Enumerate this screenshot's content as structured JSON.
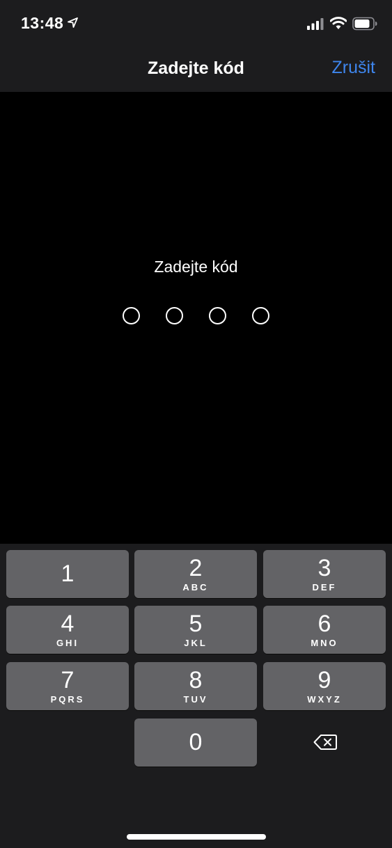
{
  "status_bar": {
    "time": "13:48",
    "icons": [
      "location-arrow-icon",
      "cellular-signal-icon",
      "wifi-icon",
      "battery-icon"
    ]
  },
  "nav": {
    "title": "Zadejte kód",
    "cancel_label": "Zrušit"
  },
  "prompt": {
    "text": "Zadejte kód",
    "digits_entered": 0,
    "digits_total": 4
  },
  "keypad": {
    "keys": [
      {
        "digit": "1",
        "letters": ""
      },
      {
        "digit": "2",
        "letters": "ABC"
      },
      {
        "digit": "3",
        "letters": "DEF"
      },
      {
        "digit": "4",
        "letters": "GHI"
      },
      {
        "digit": "5",
        "letters": "JKL"
      },
      {
        "digit": "6",
        "letters": "MNO"
      },
      {
        "digit": "7",
        "letters": "PQRS"
      },
      {
        "digit": "8",
        "letters": "TUV"
      },
      {
        "digit": "9",
        "letters": "WXYZ"
      },
      {
        "digit": "0",
        "letters": ""
      }
    ],
    "delete_icon": "backspace-icon"
  },
  "colors": {
    "accent": "#3e86ee",
    "background": "#000000",
    "bar_background": "#1c1c1e",
    "key_background": "#636366"
  }
}
